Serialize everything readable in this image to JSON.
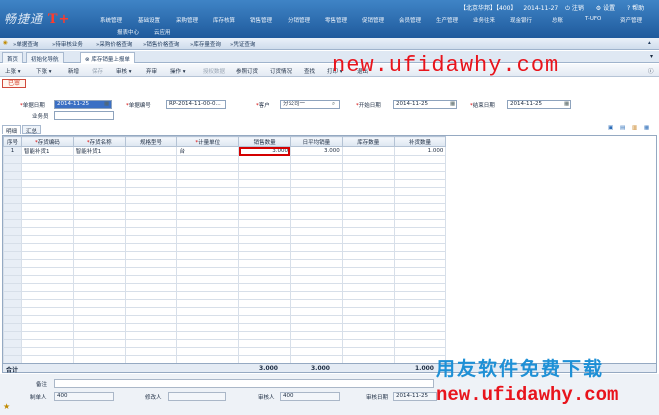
{
  "header": {
    "logo_text": "畅捷通",
    "logo_brand": "T+",
    "top_info": [
      "【北京华邦】【400】",
      "2014-11-27",
      "注销",
      "设置",
      "帮助"
    ],
    "main_menu": [
      "系统管理",
      "基础设置",
      "采购管理",
      "库存核算",
      "销售管理",
      "分销管理",
      "零售管理",
      "促销管理",
      "会员管理",
      "生产管理",
      "业务往来",
      "现金银行",
      "总账",
      "T-UFO",
      "资产管理"
    ],
    "sub_menu": [
      "报表中心",
      "云应用"
    ]
  },
  "quick_bar": [
    "单据查询",
    "待审核业务",
    "采购价格查询",
    "销售价格查询",
    "库存量查询",
    "凭证查询"
  ],
  "tabs": [
    "首页",
    "初始化导航",
    "库存销量上报单"
  ],
  "toolbar": [
    "上张",
    "下张",
    "新增",
    "保存",
    "审核",
    "弃审",
    "操作",
    "授权数据",
    "参照订货",
    "订货情况",
    "查找",
    "打印",
    "退出"
  ],
  "toolbar_disabled": [
    "保存",
    "授权数据"
  ],
  "status_badge": "已审",
  "form": {
    "doc_date_label": "单据日期",
    "doc_date": "2014-11-25",
    "doc_no_label": "单据编号",
    "doc_no": "RP-2014-11-00-0...",
    "customer_label": "客户",
    "customer": "分公司一",
    "start_label": "开始日期",
    "start_date": "2014-11-25",
    "end_label": "结束日期",
    "end_date": "2014-11-25",
    "clerk_label": "业务员",
    "clerk": ""
  },
  "detail_tabs": [
    "明细",
    "汇总"
  ],
  "grid": {
    "columns": [
      "序号",
      "存货编码",
      "存货名称",
      "规格型号",
      "计量单位",
      "销售数量",
      "日平均销量",
      "库存数量",
      "补货数量"
    ],
    "required": [
      false,
      true,
      true,
      false,
      true,
      false,
      false,
      false,
      false
    ],
    "rows": [
      [
        "1",
        "智能补货1",
        "智能补货1",
        "",
        "台",
        "3.000",
        "3.000",
        "",
        "1.000"
      ]
    ],
    "total_label": "合计",
    "totals": {
      "sales": "3.000",
      "daily": "3.000",
      "replen": "1.000"
    }
  },
  "footer": {
    "remark_label": "备注",
    "remark": "",
    "maker_label": "制单人",
    "maker": "400",
    "modifier_label": "修改人",
    "modifier": "",
    "auditor_label": "审核人",
    "auditor": "400",
    "audit_date_label": "审核日期",
    "audit_date": "2014-11-25"
  },
  "watermarks": {
    "url": "new.ufidawhy.com",
    "cn": "用友软件免费下载"
  },
  "colors": {
    "header": "#2b6cb0",
    "highlight": "#d40000",
    "watermark": "#e8141c"
  }
}
